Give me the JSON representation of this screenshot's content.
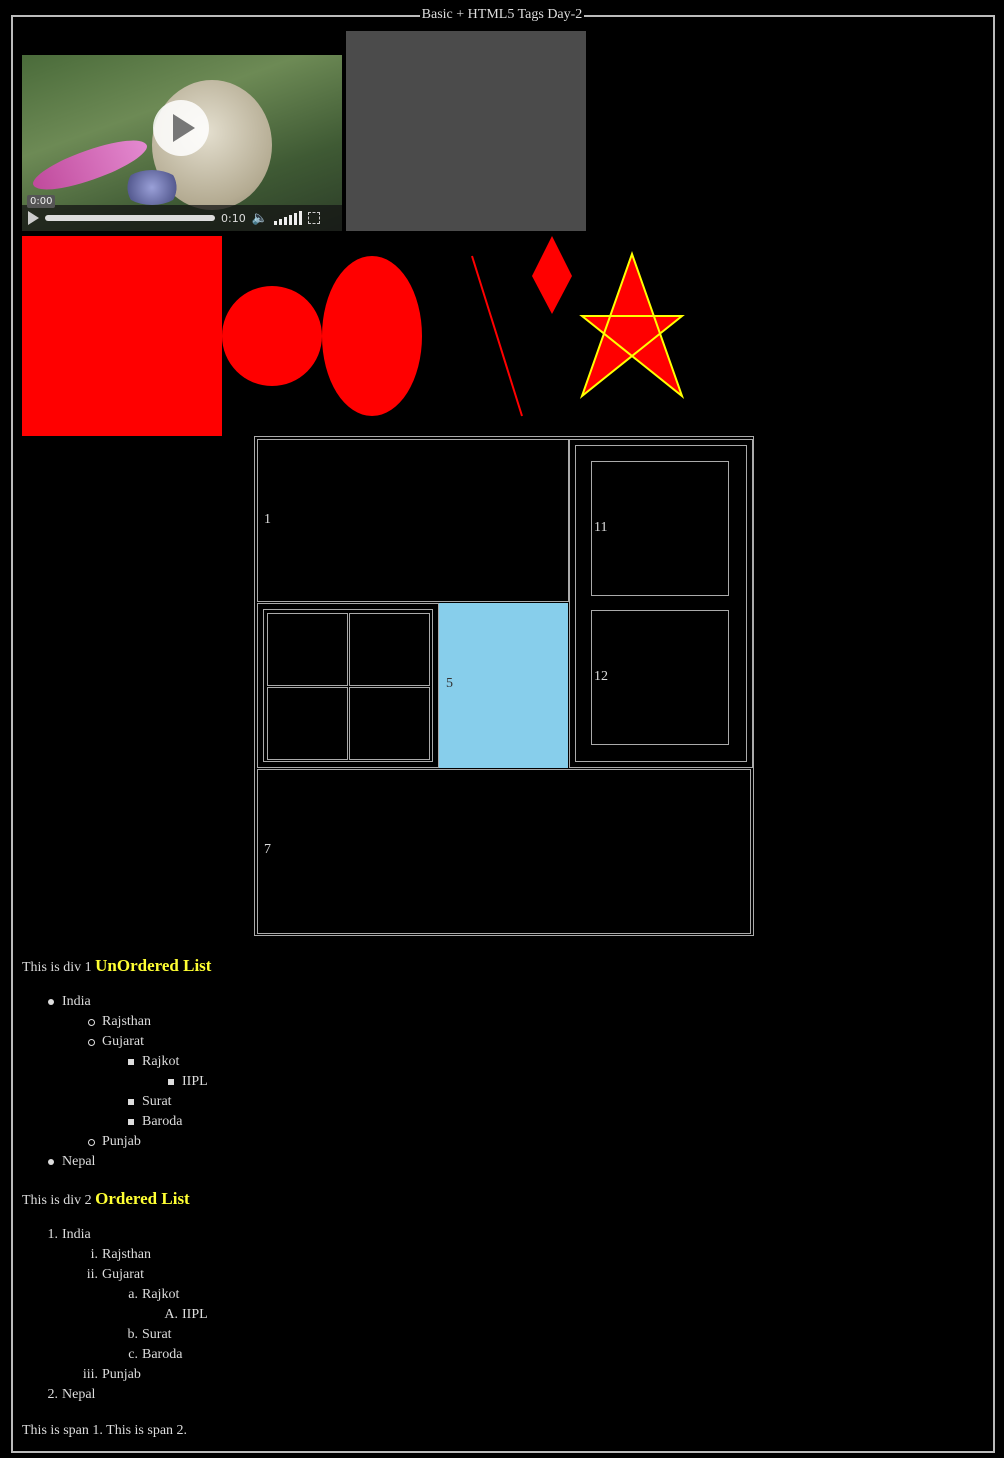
{
  "page": {
    "legend": "Basic + HTML5 Tags Day-2"
  },
  "video": {
    "current_time": "0:00",
    "duration": "0:10"
  },
  "table": {
    "cells": [
      "1",
      "11",
      "12",
      "5",
      "7"
    ]
  },
  "div1": {
    "prefix": "This is div 1",
    "heading": "UnOrdered List",
    "items": [
      "India",
      "Rajsthan",
      "Gujarat",
      "Rajkot",
      "IIPL",
      "Surat",
      "Baroda",
      "Punjab",
      "Nepal"
    ]
  },
  "div2": {
    "prefix": "This is div 2",
    "heading": "Ordered List",
    "items": [
      "India",
      "Rajsthan",
      "Gujarat",
      "Rajkot",
      "IIPL",
      "Surat",
      "Baroda",
      "Punjab",
      "Nepal"
    ],
    "markers": [
      "1.",
      "i.",
      "ii.",
      "a.",
      "A.",
      "b.",
      "c.",
      "iii.",
      "2."
    ]
  },
  "spans": {
    "span1": "This is span 1.",
    "span2": "This is span 2."
  },
  "colors": {
    "shape_fill": "#ff0000",
    "star_stroke": "#ffff00",
    "highlight_cell": "#87ceeb",
    "heading": "#ffff33"
  }
}
